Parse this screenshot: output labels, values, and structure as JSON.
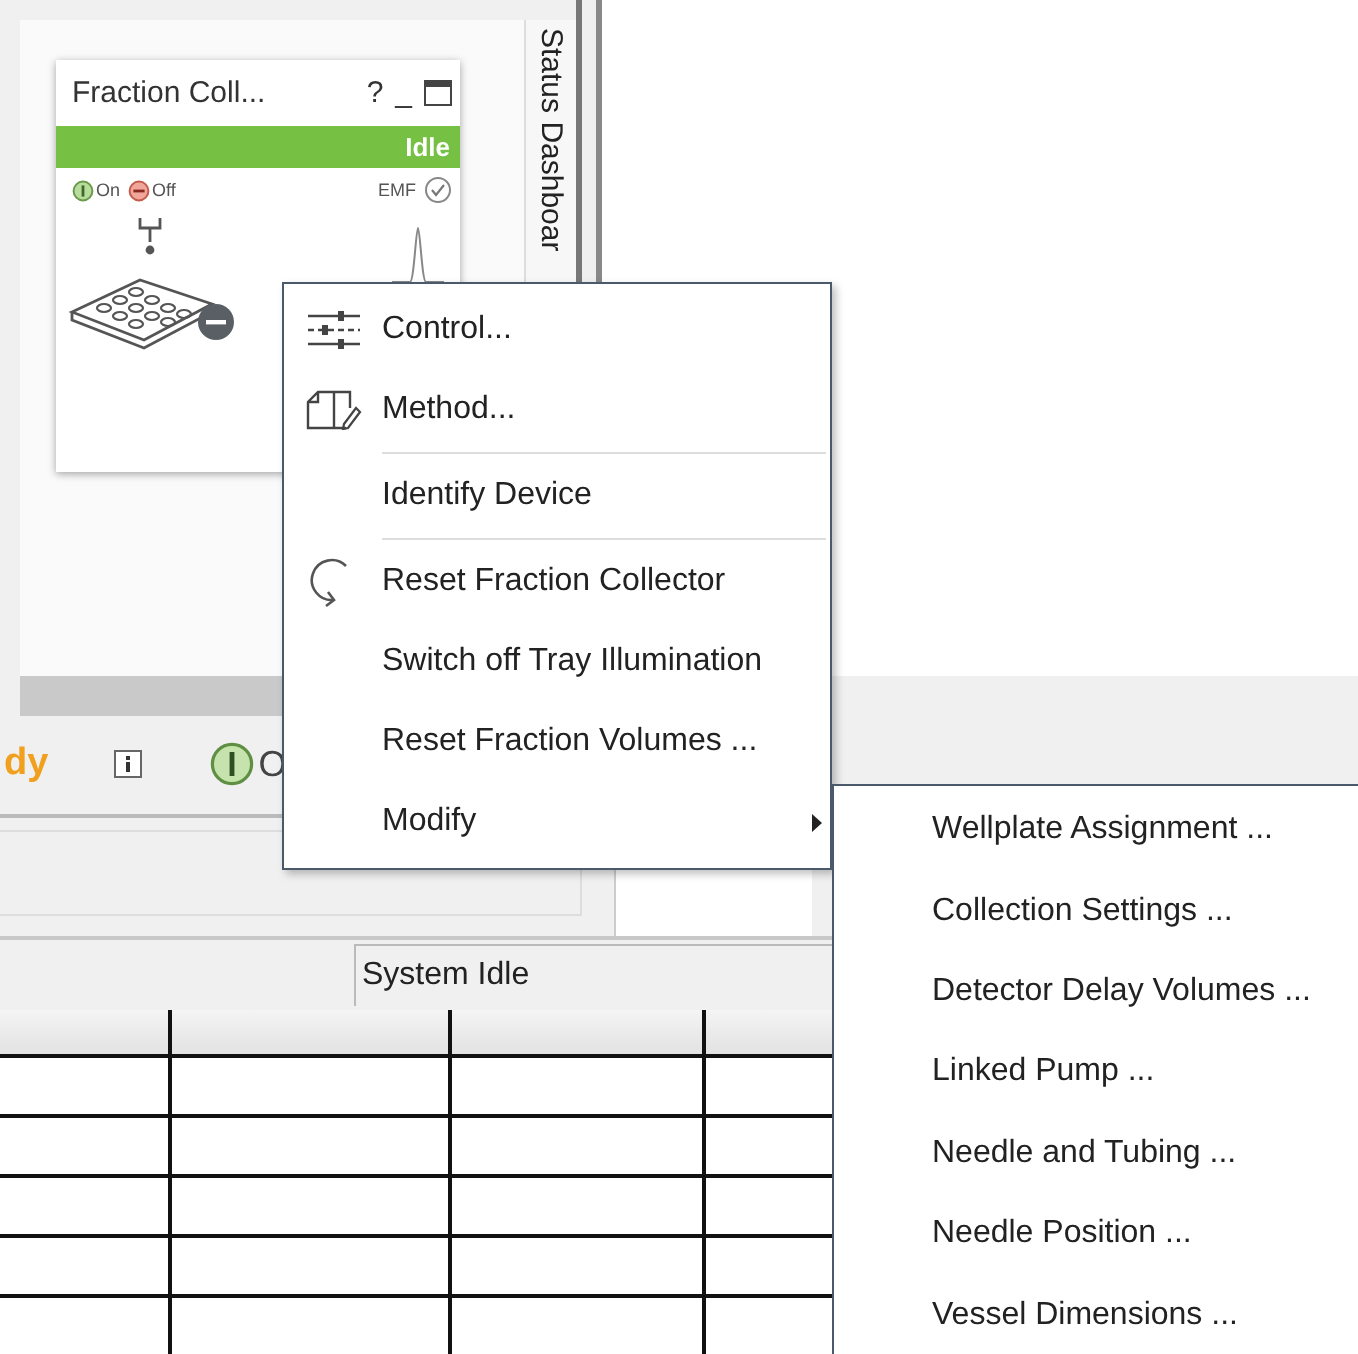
{
  "device_card": {
    "title": "Fraction Coll...",
    "help": "?",
    "minimize": "_",
    "status": "Idle",
    "on_label": "On",
    "off_label": "Off",
    "emf_label": "EMF"
  },
  "side_tab": {
    "label": "Status Dashboar"
  },
  "status_row": {
    "state_text": "dy",
    "power_text": "O"
  },
  "status_bar": {
    "text": "System Idle"
  },
  "context_menu": {
    "items": [
      {
        "kind": "sliders",
        "label": "Control..."
      },
      {
        "kind": "document",
        "label": "Method..."
      },
      {
        "kind": "separator"
      },
      {
        "kind": "plain",
        "label": "Identify Device"
      },
      {
        "kind": "separator"
      },
      {
        "kind": "refresh",
        "label": "Reset Fraction Collector"
      },
      {
        "kind": "plain",
        "label": "Switch off Tray Illumination"
      },
      {
        "kind": "plain",
        "label": "Reset Fraction Volumes ..."
      },
      {
        "kind": "submenu",
        "label": "Modify"
      }
    ]
  },
  "submenu": {
    "items": [
      {
        "label": "Wellplate Assignment ..."
      },
      {
        "label": "Collection Settings ..."
      },
      {
        "label": "Detector Delay Volumes ..."
      },
      {
        "label": "Linked Pump ..."
      },
      {
        "label": "Needle and Tubing ..."
      },
      {
        "label": "Needle Position ..."
      },
      {
        "label": "Vessel Dimensions ..."
      }
    ]
  }
}
